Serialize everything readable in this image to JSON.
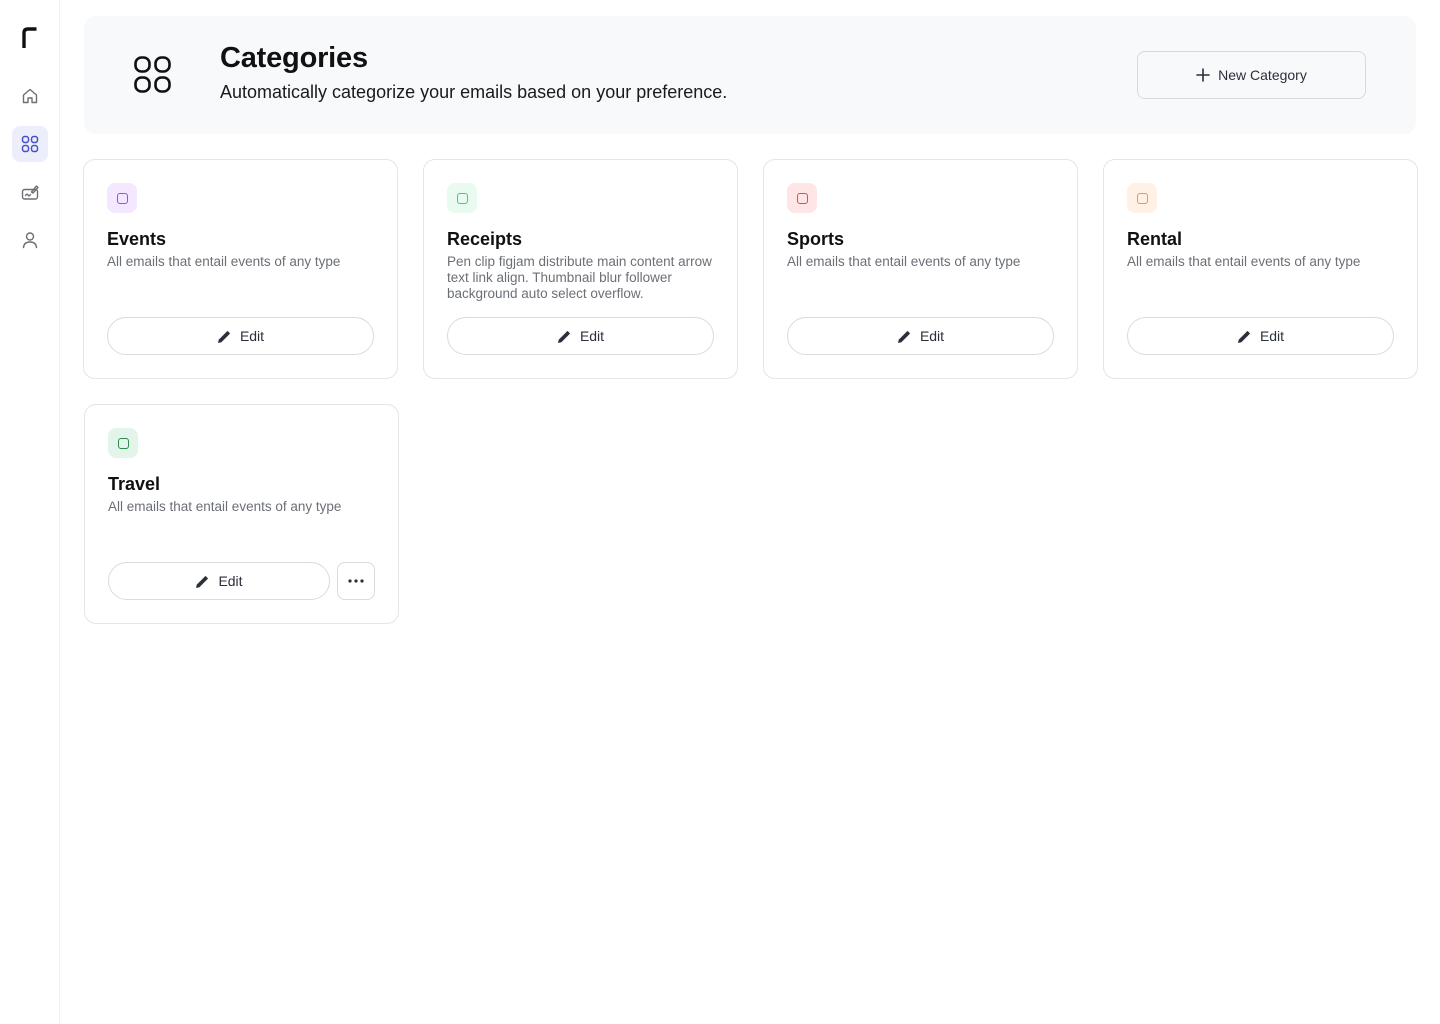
{
  "sidebar": {
    "items": [
      {
        "name": "home",
        "icon": "home-icon",
        "active": false
      },
      {
        "name": "categories",
        "icon": "grid-icon",
        "active": true
      },
      {
        "name": "compose",
        "icon": "signature-icon",
        "active": false
      },
      {
        "name": "profile",
        "icon": "user-icon",
        "active": false
      }
    ]
  },
  "header": {
    "icon": "grid-icon",
    "title": "Categories",
    "subtitle": "Automatically categorize your emails based on your preference.",
    "new_button_label": "New Category",
    "new_button_icon": "plus-icon"
  },
  "cards": [
    {
      "title": "Events",
      "description": "All emails that entail events of any type",
      "edit_label": "Edit",
      "badge_bg": "#f3e8ff",
      "badge_color": "#9b4dea"
    },
    {
      "title": "Receipts",
      "description": "Pen clip figjam distribute main content arrow text link align. Thumbnail blur follower background auto select overflow.",
      "edit_label": "Edit",
      "badge_bg": "#e9fbf0",
      "badge_color": "#3ccf78"
    },
    {
      "title": "Sports",
      "description": "All emails that entail events of any type",
      "edit_label": "Edit",
      "badge_bg": "#ffe6e6",
      "badge_color": "#e5484d"
    },
    {
      "title": "Rental",
      "description": "All emails that entail events of any type",
      "edit_label": "Edit",
      "badge_bg": "#fff1e6",
      "badge_color": "#f59445"
    },
    {
      "title": "Travel",
      "description": "All emails that entail events of any type",
      "edit_label": "Edit",
      "badge_bg": "#e3f5ea",
      "badge_color": "#2d8a4e"
    }
  ]
}
